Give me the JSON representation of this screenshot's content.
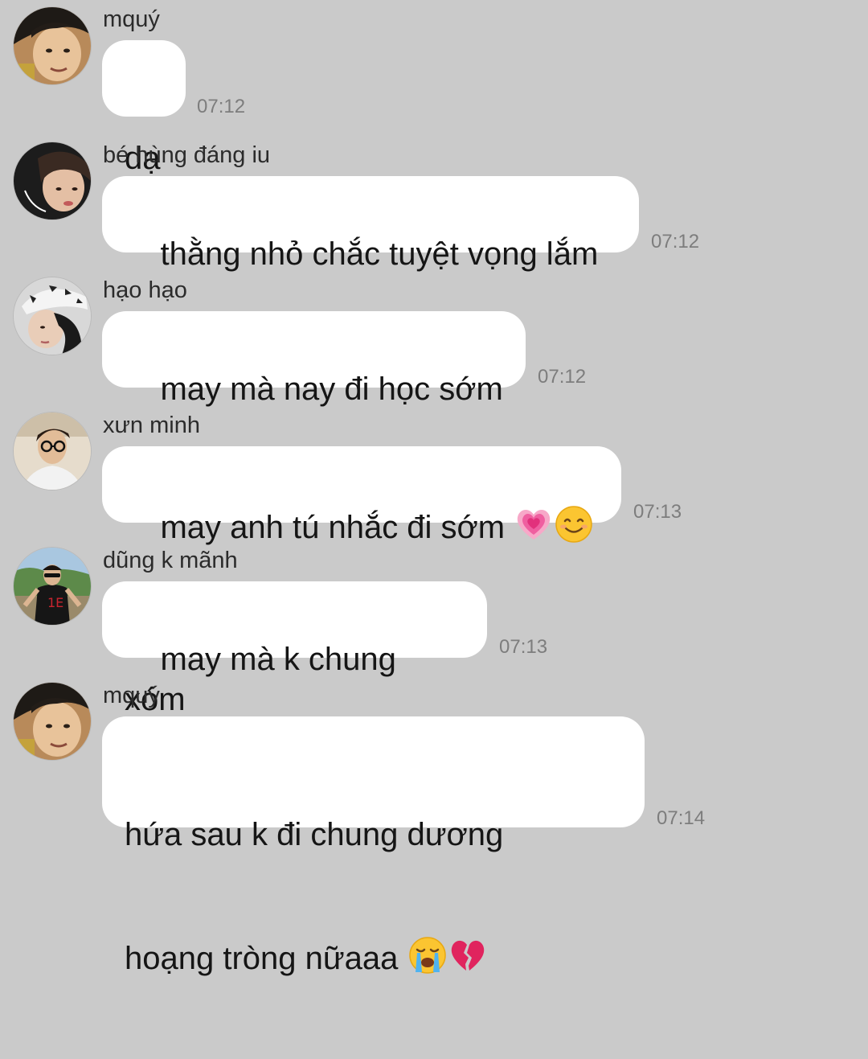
{
  "messages": [
    {
      "sender": "mquý",
      "text": "dạ",
      "time": "07:12",
      "avatar": "avatar-mquy"
    },
    {
      "sender": "bé hùng đáng iu",
      "text": "thằng nhỏ chắc tuyệt vọng lắm",
      "time": "07:12",
      "avatar": "avatar-be-hung"
    },
    {
      "sender": "hạo hạo",
      "text": "may mà nay đi học sớm",
      "time": "07:12",
      "avatar": "avatar-hao-hao"
    },
    {
      "sender": "xưn minh",
      "text": "may anh tú nhắc đi sớm ",
      "time": "07:13",
      "avatar": "avatar-xun-minh",
      "emojis": [
        "growing-heart-emoji",
        "smiling-face-emoji"
      ]
    },
    {
      "sender": "dũng k mãnh",
      "text": "may mà k chung xóm",
      "time": "07:13",
      "avatar": "avatar-dung"
    },
    {
      "sender": "mquý",
      "text_line1": "hứa sau k đi chung dương",
      "text_line2": "hoạng tròng nữaaa ",
      "time": "07:14",
      "avatar": "avatar-mquy",
      "emojis": [
        "loudly-crying-face-emoji",
        "broken-heart-emoji"
      ]
    }
  ],
  "colors": {
    "background": "#cacaca",
    "bubble": "#ffffff",
    "text": "#151515",
    "time": "#7d7d7d"
  }
}
